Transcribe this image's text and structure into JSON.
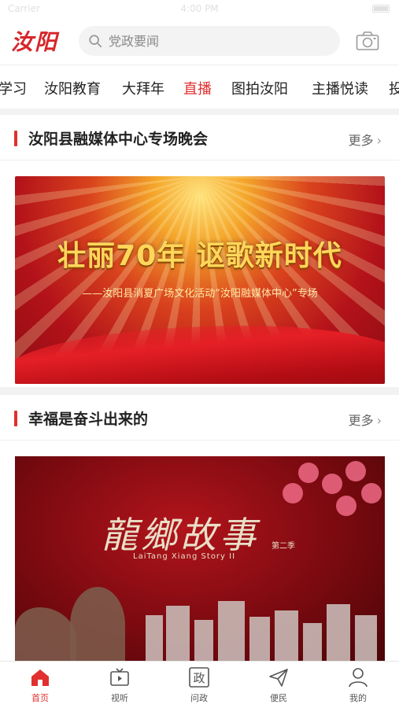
{
  "status_bar": {
    "carrier": "Carrier",
    "time": "4:00 PM"
  },
  "header": {
    "logo_text": "汝阳",
    "search_placeholder": "党政要闻",
    "camera_icon": "camera-icon"
  },
  "tabs": [
    {
      "label": "学习",
      "active": false
    },
    {
      "label": "汝阳教育",
      "active": false
    },
    {
      "label": "大拜年",
      "active": false
    },
    {
      "label": "直播",
      "active": true
    },
    {
      "label": "图拍汝阳",
      "active": false
    },
    {
      "label": "主播悦读",
      "active": false
    },
    {
      "label": "投",
      "active": false
    }
  ],
  "sections": [
    {
      "title": "汝阳县融媒体中心专场晚会",
      "more_label": "更多",
      "banner": {
        "slogan": "壮丽70年 讴歌新时代",
        "subtitle": "——汝阳县消夏广场文化活动“汝阳融媒体中心”专场"
      }
    },
    {
      "title": "幸福是奋斗出来的",
      "more_label": "更多",
      "banner": {
        "calligraphy": "龍鄉故事",
        "english": "LaiTang Xiang Story II",
        "episode": "第二季"
      }
    }
  ],
  "bottom_nav": [
    {
      "label": "首页",
      "icon": "home-icon",
      "active": true
    },
    {
      "label": "视听",
      "icon": "tv-icon",
      "active": false
    },
    {
      "label": "问政",
      "icon": "zheng-icon",
      "active": false
    },
    {
      "label": "便民",
      "icon": "send-icon",
      "active": false
    },
    {
      "label": "我的",
      "icon": "user-icon",
      "active": false
    }
  ],
  "colors": {
    "accent": "#e0302f",
    "background": "#f2f2f2"
  }
}
